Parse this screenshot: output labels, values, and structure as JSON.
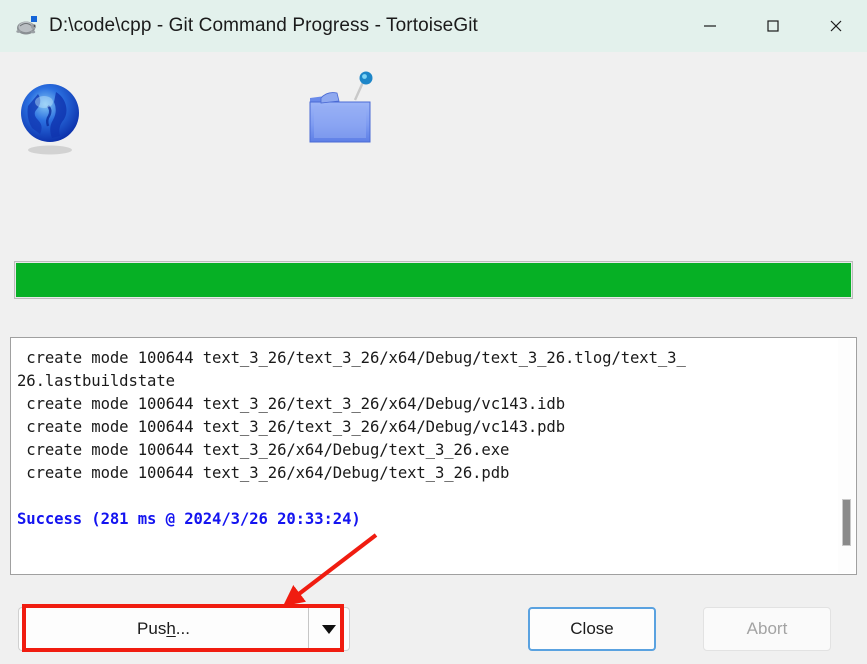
{
  "window": {
    "title": "D:\\code\\cpp - Git Command Progress - TortoiseGit",
    "app_icon": "tortoisegit-turtle-icon",
    "titlebar_color": "#e3f1ec",
    "controls": {
      "minimize_label": "—",
      "maximize_label": "□",
      "close_label": "✕"
    }
  },
  "icons": {
    "remote": "globe-icon",
    "local": "folder-with-pin-icon"
  },
  "progress": {
    "percent": 100,
    "color": "#06b025"
  },
  "log": {
    "lines": [
      " create mode 100644 text_3_26/text_3_26/x64/Debug/text_3_26.tlog/text_3_",
      "26.lastbuildstate",
      " create mode 100644 text_3_26/text_3_26/x64/Debug/vc143.idb",
      " create mode 100644 text_3_26/text_3_26/x64/Debug/vc143.pdb",
      " create mode 100644 text_3_26/x64/Debug/text_3_26.exe",
      " create mode 100644 text_3_26/x64/Debug/text_3_26.pdb"
    ],
    "success": "Success (281 ms @ 2024/3/26 20:33:24)",
    "success_color": "#1414f0"
  },
  "buttons": {
    "push_prefix": "Pus",
    "push_accel": "h",
    "push_suffix": "...",
    "push_dropdown_icon": "chevron-down-icon",
    "close": "Close",
    "abort": "Abort"
  },
  "annotation": {
    "highlight_color": "#f01c10",
    "arrow_color": "#f01c10"
  }
}
